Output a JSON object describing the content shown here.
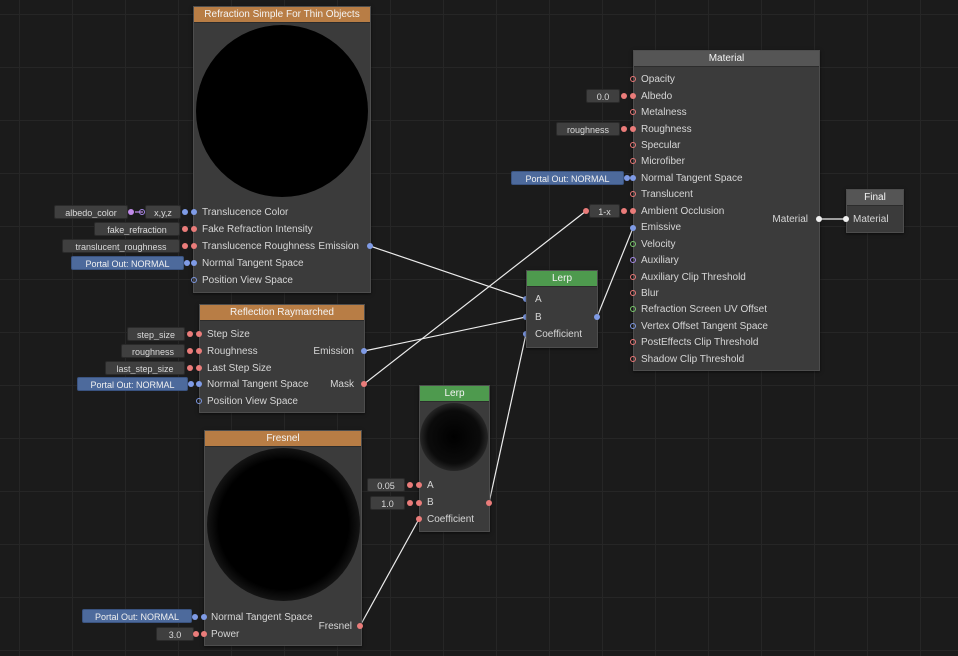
{
  "nodes": {
    "refraction": {
      "title": "Refraction Simple For Thin Objects",
      "inputs": [
        "Translucence Color",
        "Fake Refraction Intensity",
        "Translucence Roughness",
        "Normal Tangent Space",
        "Position View Space"
      ],
      "output": "Emission"
    },
    "reflection": {
      "title": "Reflection Raymarched",
      "inputs": [
        "Step Size",
        "Roughness",
        "Last Step Size",
        "Normal Tangent Space",
        "Position View Space"
      ],
      "outputs": [
        "Emission",
        "Mask"
      ]
    },
    "fresnel": {
      "title": "Fresnel",
      "inputs": [
        "Normal Tangent Space",
        "Power"
      ],
      "output": "Fresnel"
    },
    "lerp_top": {
      "title": "Lerp",
      "inputs": [
        "A",
        "B",
        "Coefficient"
      ]
    },
    "lerp_bottom": {
      "title": "Lerp",
      "inputs": [
        "A",
        "B",
        "Coefficient"
      ]
    },
    "material": {
      "title": "Material",
      "inputs": [
        "Opacity",
        "Albedo",
        "Metalness",
        "Roughness",
        "Specular",
        "Microfiber",
        "Normal Tangent Space",
        "Translucent",
        "Ambient Occlusion",
        "Emissive",
        "Velocity",
        "Auxiliary",
        "Auxiliary Clip Threshold",
        "Blur",
        "Refraction Screen UV Offset",
        "Vertex Offset Tangent Space",
        "PostEffects Clip Threshold",
        "Shadow Clip Threshold"
      ],
      "output": "Material"
    },
    "final": {
      "title": "Final",
      "input": "Material"
    }
  },
  "chips": {
    "albedo_color": "albedo_color",
    "xyz": "x,y,z",
    "fake_refraction": "fake_refraction",
    "translucent_roughness": "translucent_roughness",
    "portal_refraction": "Portal Out: NORMAL",
    "step_size": "step_size",
    "roughness_refl": "roughness",
    "last_step_size": "last_step_size",
    "portal_reflection": "Portal Out: NORMAL",
    "portal_fresnel": "Portal Out: NORMAL",
    "power": "3.0",
    "lerp_a": "0.05",
    "lerp_b": "1.0",
    "albedo_value": "0.0",
    "roughness_mat": "roughness",
    "portal_material": "Portal Out: NORMAL",
    "one_minus_x": "1-x"
  },
  "colors": {
    "background": "#1b1b1b",
    "node_body": "#3b3b3b",
    "header_orange": "#b87d45",
    "header_green": "#4e9a4e",
    "header_gray": "#555555",
    "pin_blue": "#7f9be6",
    "pin_red": "#ea7c7a",
    "portal_chip": "#4d6a9c"
  }
}
